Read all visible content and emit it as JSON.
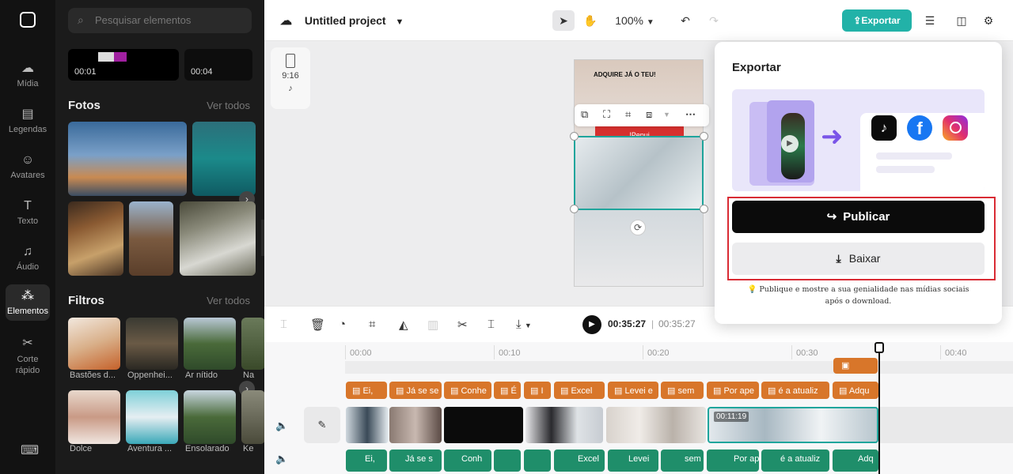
{
  "rail": {
    "items": [
      {
        "label": "Mídia",
        "icon": "cloud-upload-icon"
      },
      {
        "label": "Legendas",
        "icon": "captions-icon"
      },
      {
        "label": "Avatares",
        "icon": "avatar-icon"
      },
      {
        "label": "Texto",
        "icon": "text-icon"
      },
      {
        "label": "Áudio",
        "icon": "music-note-icon"
      },
      {
        "label": "Elementos",
        "icon": "shapes-icon"
      },
      {
        "label": "Corte rápido",
        "icon": "scissors-icon"
      }
    ]
  },
  "library": {
    "search_placeholder": "Pesquisar elementos",
    "top_clips": [
      {
        "duration": "00:01"
      },
      {
        "duration": "00:04"
      }
    ],
    "photos_title": "Fotos",
    "photos_see_all": "Ver todos",
    "filters_title": "Filtros",
    "filters_see_all": "Ver todos",
    "filters": [
      {
        "name": "Bastões d..."
      },
      {
        "name": "Oppenhei..."
      },
      {
        "name": "Ar nítido"
      },
      {
        "name": "Na"
      }
    ],
    "filters_row2": [
      {
        "name": "Dolce"
      },
      {
        "name": "Aventura ..."
      },
      {
        "name": "Ensolarado"
      },
      {
        "name": "Ke"
      }
    ]
  },
  "topbar": {
    "project_name": "Untitled project",
    "zoom": "100%",
    "export_label": "Exportar"
  },
  "canvas": {
    "ratio": "9:16",
    "banner_text": "ADQUIRE JÁ O TEU!",
    "red_text": "!Pepui"
  },
  "player": {
    "current_time": "00:35:27",
    "separator": "|",
    "total_time": "00:35:27"
  },
  "timeline": {
    "ruler": [
      "00:00",
      "00:10",
      "00:20",
      "00:30",
      "00:40"
    ],
    "text_clips": [
      "Ei, ",
      "Já se se",
      "Conhe",
      "É",
      "I",
      "Excel",
      "Levei e",
      "sem",
      "Por ape",
      "é a atualiz",
      "Adqu"
    ],
    "audio_clips": [
      "Ei,",
      "Já se s",
      "Conh",
      "",
      "",
      "Excel",
      "Levei",
      "sem",
      "Por ap",
      "é a atualiz",
      "Adq"
    ],
    "selected_clip_time": "00:11:19",
    "edit_label": "✎"
  },
  "export_popover": {
    "title": "Exportar",
    "publish_label": "Publicar",
    "download_label": "Baixar",
    "tip": "Publique e mostre a sua genialidade nas mídias sociais após o download."
  },
  "colors": {
    "accent": "#22b2a8",
    "highlight": "#d92b34",
    "text_clip": "#d8762a",
    "audio_clip": "#1f8e6a"
  }
}
